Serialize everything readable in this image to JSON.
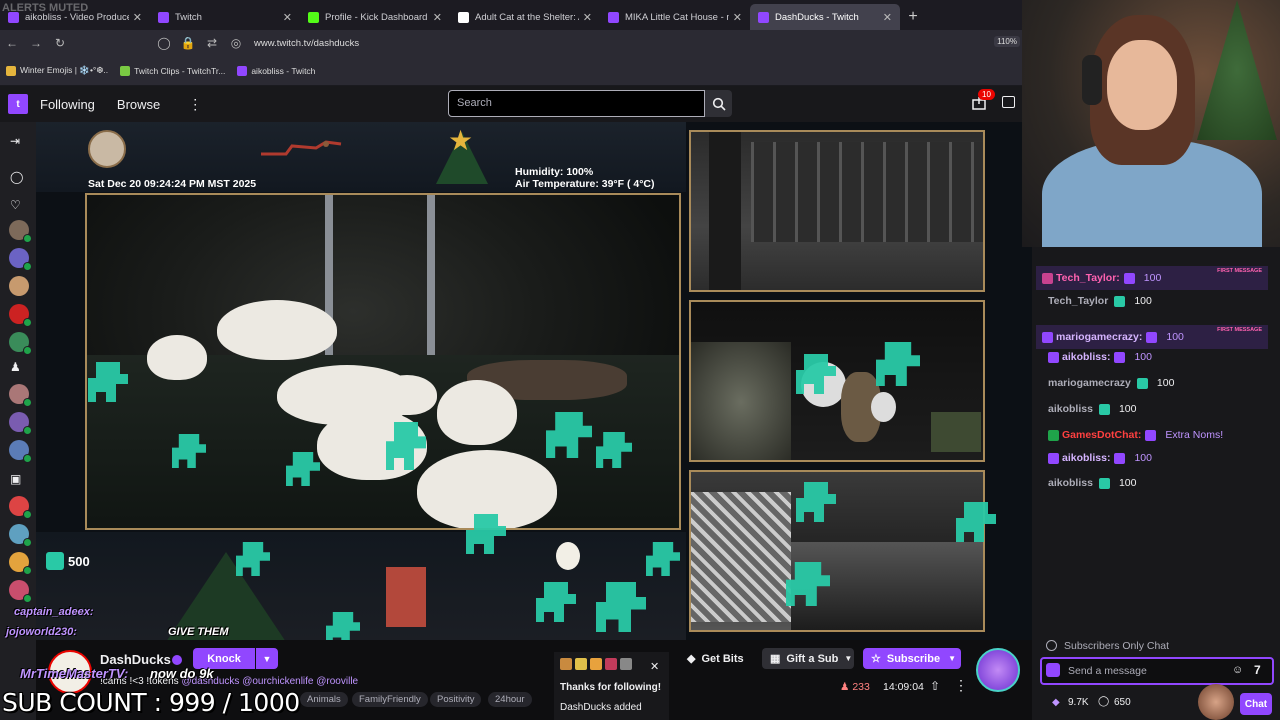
{
  "browser": {
    "tabs": [
      {
        "label": "aikobliss - Video Producer - Twi",
        "color": "#9147ff"
      },
      {
        "label": "Twitch",
        "color": "#9147ff"
      },
      {
        "label": "Profile - Kick Dashboard",
        "color": "#53fc18"
      },
      {
        "label": "Adult Cat at the Shelter: A Hear",
        "color": "#ffffff"
      },
      {
        "label": "MIKA Little Cat House - meow.c",
        "color": "#9147ff"
      },
      {
        "label": "DashDucks - Twitch",
        "color": "#9147ff"
      }
    ],
    "new_tab": "+",
    "url": "www.twitch.tv/dashducks",
    "zoom": "110%",
    "bookmarks": [
      "Winter Emojis | ❄️•°❆..",
      "Twitch Clips - TwitchTr...",
      "aikobliss - Twitch"
    ]
  },
  "twitch_nav": {
    "logo": "t",
    "following": "Following",
    "browse": "Browse",
    "search_placeholder": "Search",
    "notifications_count": "10"
  },
  "stream_overlay": {
    "alert_muted": "ALERTS MUTED",
    "datetime": "Sat Dec 20 09:24:24 PM MST 2025",
    "humidity": "Humidity: 100%",
    "air_temperature": "Air Temperature: 39°F ( 4°C)",
    "points": "500",
    "chat_overlay": [
      {
        "user": "captain_adeex:",
        "text": ""
      },
      {
        "user": "jojoworld230:",
        "text": "GIVE THEM"
      },
      {
        "user": "MrTimeMasterTV:",
        "text": "now do 9k"
      }
    ],
    "sub_count": "SUB COUNT : 999 / 1000"
  },
  "stream_info": {
    "channel": "DashDucks",
    "knock_label": "Knock",
    "title_prefix": "!cams !<3 !tokens",
    "title_mentions": [
      "@dashducks",
      "@ourchickenlife",
      "@rooville"
    ],
    "tags": [
      "Animals",
      "FamilyFriendly",
      "Positivity",
      "24hour"
    ],
    "get_bits": "Get Bits",
    "gift_sub": "Gift a Sub",
    "subscribe": "Subscribe",
    "viewers": "233",
    "uptime": "14:09:04",
    "notice_title": "Thanks for following!",
    "notice_body": "DashDucks added"
  },
  "chat": {
    "messages": [
      {
        "user": "Tech_Taylor:",
        "text": "100",
        "first": true,
        "user_color": "#ff62b0",
        "badge_color": "#c8428f"
      },
      {
        "user": "Tech_Taylor",
        "text": "100",
        "first": false,
        "plain": true,
        "badge_color": "#29c9a6"
      },
      {
        "user": "mariogamecrazy:",
        "text": "100",
        "first": true,
        "user_color": "#d5b4ff",
        "badge_color": "#9147ff"
      },
      {
        "user": "aikobliss:",
        "text": "100",
        "first": false,
        "user_color": "#d5b4ff",
        "badge_color": "#9147ff"
      },
      {
        "user": "mariogamecrazy",
        "text": "100",
        "first": false,
        "plain": true,
        "badge_color": "#29c9a6"
      },
      {
        "user": "aikobliss",
        "text": "100",
        "first": false,
        "plain": true,
        "badge_color": "#29c9a6"
      },
      {
        "user": "GamesDotChat:",
        "text": "Extra Noms!",
        "first": false,
        "user_color": "#ff4040",
        "badge_color": "#1fa34a"
      },
      {
        "user": "aikobliss:",
        "text": "100",
        "first": false,
        "user_color": "#d5b4ff",
        "badge_color": "#9147ff"
      },
      {
        "user": "aikobliss",
        "text": "100",
        "first": false,
        "plain": true,
        "badge_color": "#29c9a6"
      }
    ],
    "first_message_label": "FIRST MESSAGE",
    "subscribers_only": "Subscribers Only Chat",
    "input_placeholder": "Send a message",
    "points_1": "9.7K",
    "points_2": "650",
    "chat_button": "Chat"
  },
  "colors": {
    "brand": "#9147ff",
    "live": "#eb0400",
    "accent": "#29c9a6"
  }
}
